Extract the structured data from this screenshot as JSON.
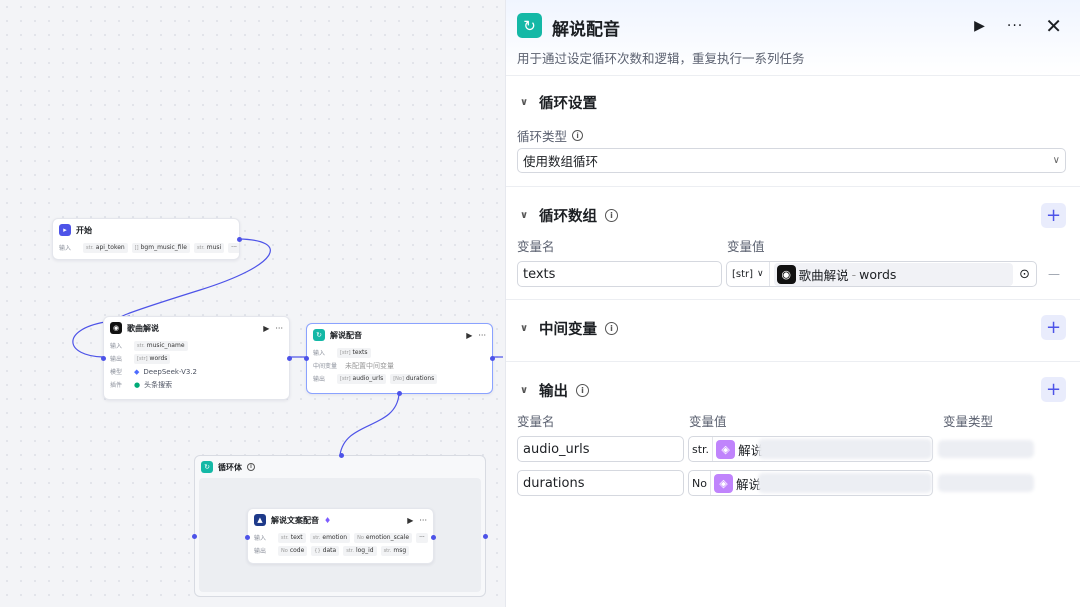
{
  "canvas": {
    "start_node": {
      "title": "开始",
      "label_input": "输入",
      "params": [
        {
          "type": "str.",
          "name": "api_token"
        },
        {
          "type": "[]",
          "name": "bgm_music_file"
        },
        {
          "type": "str.",
          "name": "musi"
        }
      ],
      "more": "···"
    },
    "song_node": {
      "title": "歌曲解说",
      "rows": [
        {
          "label": "输入",
          "type": "str.",
          "value": "music_name"
        },
        {
          "label": "输出",
          "type": "[str]",
          "value": "words"
        },
        {
          "label": "模型",
          "type": "",
          "value": "DeepSeek-V3.2"
        },
        {
          "label": "插件",
          "type": "",
          "value": "头条搜索"
        }
      ]
    },
    "dub_node": {
      "title": "解说配音",
      "rows": [
        {
          "label": "输入",
          "type": "[str]",
          "value": "texts"
        },
        {
          "label": "中间变量",
          "type": "",
          "value": "未配置中间变量"
        },
        {
          "label": "输出",
          "type": "[str]",
          "value": "audio_urls",
          "type2": "[No]",
          "value2": "durations"
        }
      ]
    },
    "loop_body": {
      "title": "循环体"
    },
    "tts_node": {
      "title": "解说文案配音",
      "rows": [
        {
          "label": "输入",
          "params": [
            {
              "type": "str.",
              "name": "text"
            },
            {
              "type": "str.",
              "name": "emotion"
            },
            {
              "type": "No",
              "name": "emotion_scale"
            }
          ],
          "more": "···"
        },
        {
          "label": "输出",
          "params": [
            {
              "type": "No",
              "name": "code"
            },
            {
              "type": "{}",
              "name": "data"
            },
            {
              "type": "str.",
              "name": "log_id"
            },
            {
              "type": "str.",
              "name": "msg"
            }
          ]
        }
      ]
    }
  },
  "panel": {
    "title": "解说配音",
    "description": "用于通过设定循环次数和逻辑，重复执行一系列任务",
    "loop_settings": {
      "heading": "循环设置",
      "type_label": "循环类型",
      "type_value": "使用数组循环"
    },
    "loop_array": {
      "heading": "循环数组",
      "col_name": "变量名",
      "col_value": "变量值",
      "name": "texts",
      "type": "[str]",
      "ref_source": "歌曲解说",
      "ref_sep": "-",
      "ref_var": "words",
      "remove": "—"
    },
    "intermediate": {
      "heading": "中间变量"
    },
    "output": {
      "heading": "输出",
      "col_name": "变量名",
      "col_value": "变量值",
      "col_type": "变量类型",
      "rows": [
        {
          "name": "audio_urls",
          "type": "str.",
          "ref": "解说"
        },
        {
          "name": "durations",
          "type": "No",
          "ref": "解说"
        }
      ]
    }
  },
  "colors": {
    "accent": "#4d53e8",
    "teal": "#14b8a6"
  }
}
